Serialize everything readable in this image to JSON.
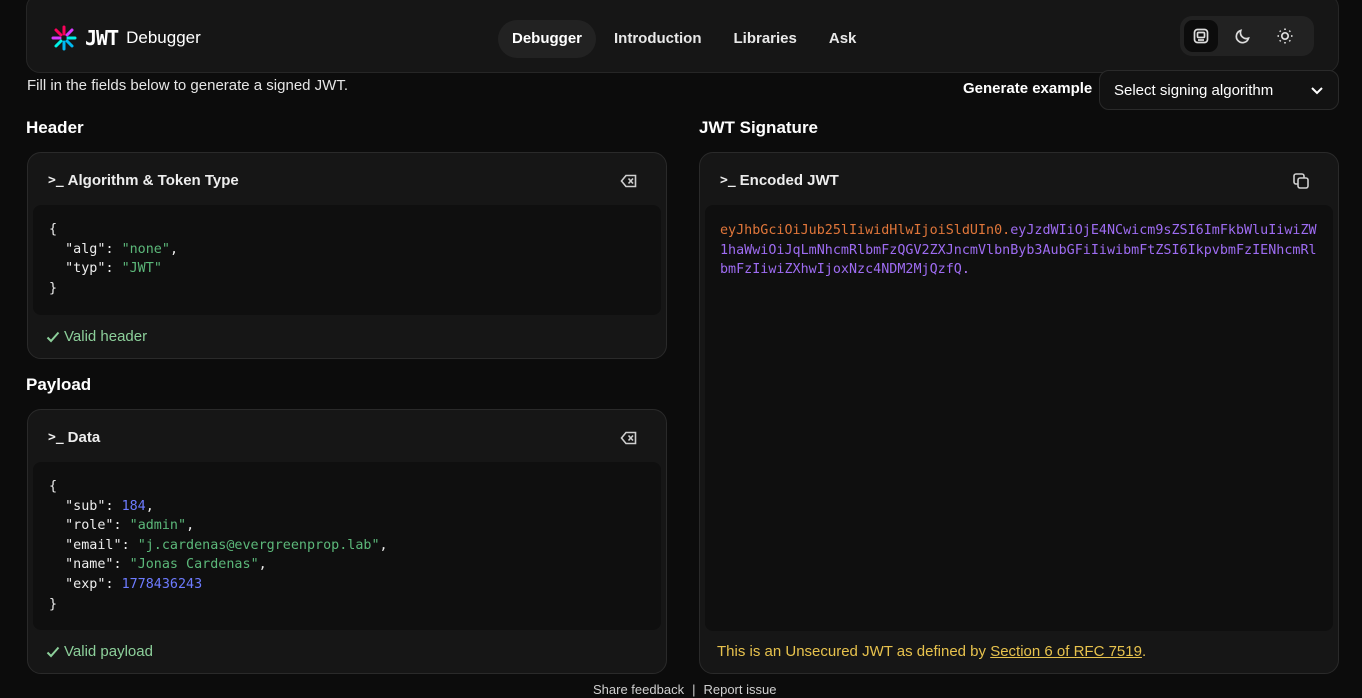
{
  "brand": {
    "logo_text": "JWT",
    "name": "Debugger"
  },
  "nav": {
    "tabs": [
      {
        "label": "Debugger",
        "active": true
      },
      {
        "label": "Introduction",
        "active": false
      },
      {
        "label": "Libraries",
        "active": false
      },
      {
        "label": "Ask",
        "active": false
      }
    ]
  },
  "theme": {
    "options": [
      "system-icon",
      "moon-icon",
      "sun-icon"
    ],
    "active": "system-icon"
  },
  "intro_text": "Fill in the fields below to generate a signed JWT.",
  "generate": {
    "label": "Generate example",
    "select_value": "Select signing algorithm"
  },
  "header_section": {
    "title": "Header",
    "panel_title": "Algorithm & Token Type",
    "fields": {
      "alg": "none",
      "typ": "JWT"
    },
    "status": "Valid header"
  },
  "payload_section": {
    "title": "Payload",
    "panel_title": "Data",
    "fields": {
      "sub": "184",
      "role": "admin",
      "email": "j.cardenas@evergreenprop.lab",
      "name": "Jonas Cardenas",
      "exp": "1778436243"
    },
    "status": "Valid payload"
  },
  "signature_section": {
    "title": "JWT Signature",
    "panel_title": "Encoded JWT",
    "token_header": "eyJhbGciOiJub25lIiwidHlwIjoiSldUIn0",
    "token_payload": "eyJzdWIiOjE4NCwicm9sZSI6ImFkbWluIiwiZW1haWwiOiJqLmNhcmRlbmFzQGV2ZXJncmVlbnByb3AubGFiIiwibmFtZSI6IkpvbmFzIENhcmRlbmFzIiwiZXhwIjoxNzc4NDM2MjQzfQ",
    "token_sep": ".",
    "warning_prefix": "This is an Unsecured JWT as defined by ",
    "warning_link": "Section 6 of RFC 7519",
    "warning_suffix": "."
  },
  "colors": {
    "accent_orange": "#e0763a",
    "accent_purple": "#9e6cf2",
    "success": "#8ccf9a",
    "warning": "#e7c24d"
  },
  "footer": {
    "feedback": "Share feedback",
    "separator": "|",
    "report": "Report issue"
  }
}
